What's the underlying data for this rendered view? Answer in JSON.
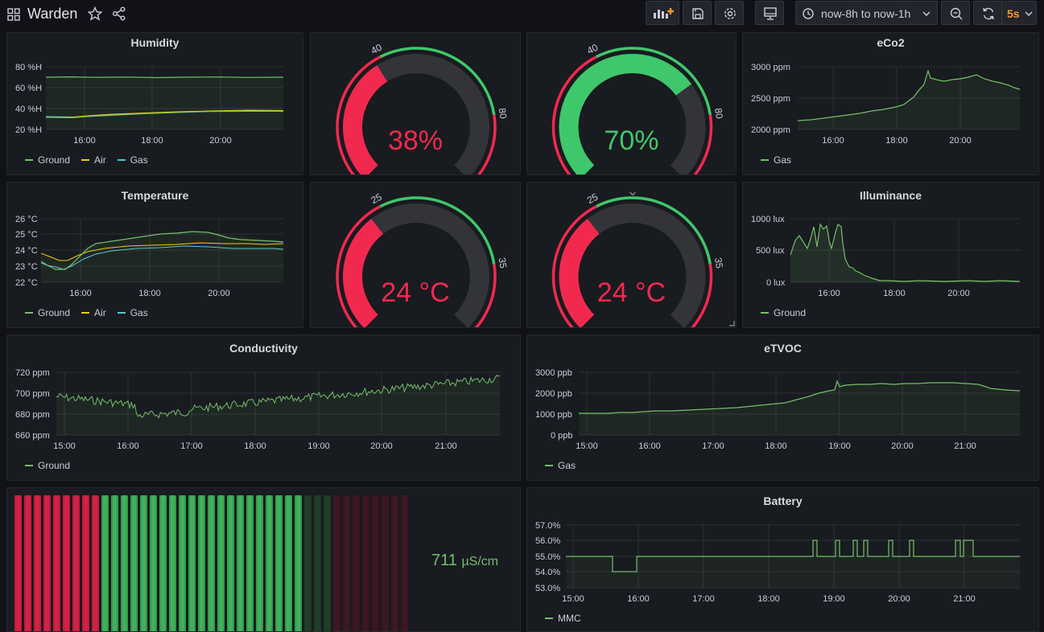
{
  "header": {
    "title": "Warden",
    "time_range": "now-8h to now-1h",
    "refresh_interval": "5s",
    "icons": [
      "apps-icon",
      "star-icon",
      "share-icon",
      "add-panel-icon",
      "save-icon",
      "settings-icon",
      "tv-mode-icon",
      "clock-icon",
      "chevron-down-icon",
      "zoom-out-icon",
      "refresh-icon"
    ]
  },
  "colors": {
    "green": "#73bf69",
    "yellow": "#f2cc0c",
    "cyan": "#5ec5d8",
    "red": "#f2294f",
    "gauge_green": "#3fc76b"
  },
  "panels": {
    "humidity": {
      "title": "Humidity",
      "yticks": [
        "80 %H",
        "60 %H",
        "40 %H",
        "20 %H"
      ],
      "xticks": [
        "16:00",
        "18:00",
        "20:00"
      ],
      "legend": [
        "Ground",
        "Air",
        "Gas"
      ]
    },
    "humidity_gauge_ground": {
      "value": "38%",
      "min": "0",
      "t1": "40",
      "t2": "80",
      "max": "100",
      "fill_fraction": 0.38
    },
    "humidity_gauge_air": {
      "value": "70%",
      "min": "0",
      "t1": "40",
      "t2": "80",
      "max": "100",
      "fill_fraction": 0.7
    },
    "eco2": {
      "title": "eCo2",
      "yticks": [
        "3000 ppm",
        "2500 ppm",
        "2000 ppm"
      ],
      "xticks": [
        "16:00",
        "18:00",
        "20:00"
      ],
      "legend": [
        "Gas"
      ]
    },
    "temperature": {
      "title": "Temperature",
      "yticks": [
        "26 °C",
        "25 °C",
        "24 °C",
        "23 °C",
        "22 °C"
      ],
      "xticks": [
        "16:00",
        "18:00",
        "20:00"
      ],
      "legend": [
        "Ground",
        "Air",
        "Gas"
      ]
    },
    "temp_gauge_ground": {
      "value": "24 °C",
      "min": "15",
      "t1": "25",
      "t2": "35",
      "max": "40",
      "fill_fraction": 0.36
    },
    "temp_gauge_air": {
      "value": "24 °C",
      "min": "15",
      "t1": "25",
      "t2": "35",
      "max": "40",
      "fill_fraction": 0.36
    },
    "illuminance": {
      "title": "Illuminance",
      "yticks": [
        "1000 lux",
        "500 lux",
        "0 lux"
      ],
      "xticks": [
        "16:00",
        "18:00",
        "20:00"
      ],
      "legend": [
        "Ground"
      ]
    },
    "conductivity": {
      "title": "Conductivity",
      "yticks": [
        "720 ppm",
        "700 ppm",
        "680 ppm",
        "660 ppm"
      ],
      "xticks": [
        "15:00",
        "16:00",
        "17:00",
        "18:00",
        "19:00",
        "20:00",
        "21:00"
      ],
      "legend": [
        "Ground"
      ]
    },
    "etvoc": {
      "title": "eTVOC",
      "yticks": [
        "3000 ppb",
        "2000 ppb",
        "1000 ppb",
        "0 ppb"
      ],
      "xticks": [
        "15:00",
        "16:00",
        "17:00",
        "18:00",
        "19:00",
        "20:00",
        "21:00"
      ],
      "legend": [
        "Gas"
      ]
    },
    "conductivity_bar": {
      "value": "711",
      "unit": "µS/cm",
      "segments_red": 9,
      "segments_green": 21,
      "segments_dark_green": 3,
      "segments_dark_red": 8,
      "lit_fraction": 0.73
    },
    "battery": {
      "title": "Battery",
      "yticks": [
        "57.0%",
        "56.0%",
        "55.0%",
        "54.0%",
        "53.0%"
      ],
      "xticks": [
        "15:00",
        "16:00",
        "17:00",
        "18:00",
        "19:00",
        "20:00",
        "21:00"
      ],
      "legend": [
        "MMC"
      ]
    }
  }
}
